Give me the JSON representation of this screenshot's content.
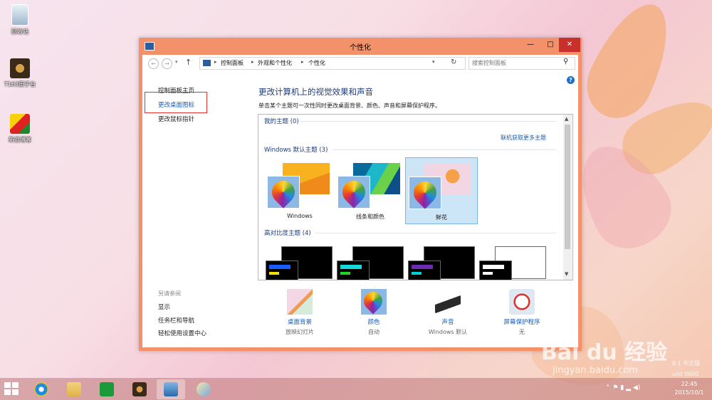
{
  "desktop": {
    "icons": [
      {
        "label": "回收站"
      },
      {
        "label": "T163田子台"
      },
      {
        "label": "新浪博客"
      }
    ]
  },
  "window": {
    "title": "个性化",
    "minimize_glyph": "—",
    "maximize_glyph": "□",
    "close_glyph": "✕"
  },
  "address": {
    "back_glyph": "←",
    "forward_glyph": "→",
    "dropdown_glyph": "▾",
    "up_glyph": "↑",
    "breadcrumb": [
      "控制面板",
      "外观和个性化",
      "个性化"
    ],
    "separator": "▸",
    "refresh_glyph": "↻",
    "search_placeholder": "搜索控制面板",
    "search_glyph": "⚲"
  },
  "sidebar": {
    "links": [
      "控制面板主页",
      "更改桌面图标",
      "更改鼠标指针"
    ],
    "see_also_title": "另请参阅",
    "see_also": [
      "显示",
      "任务栏和导航",
      "轻松使用设置中心"
    ]
  },
  "main": {
    "help": "?",
    "title": "更改计算机上的视觉效果和声音",
    "description": "单击某个主题可一次性同时更改桌面背景、颜色、声音和屏幕保护程序。",
    "my_themes": "我的主题 (0)",
    "get_more": "联机获取更多主题",
    "default_themes": "Windows 默认主题 (3)",
    "themes": [
      {
        "name": "Windows",
        "selected": false
      },
      {
        "name": "线条和颜色",
        "selected": false
      },
      {
        "name": "鲜花",
        "selected": true
      }
    ],
    "high_contrast": "高对比度主题 (4)",
    "hc_colors": [
      "#1a5cff",
      "#18d8d8",
      "#6a2cb0",
      "#ffffff"
    ],
    "scroll_up": "▲",
    "scroll_down": "▼"
  },
  "bottom": [
    {
      "title": "桌面背景",
      "subtitle": "放映幻灯片"
    },
    {
      "title": "颜色",
      "subtitle": "自动"
    },
    {
      "title": "声音",
      "subtitle": "Windows 默认"
    },
    {
      "title": "屏幕保护程序",
      "subtitle": "无"
    }
  ],
  "taskbar": {
    "clock_time": "22:45",
    "clock_date": "2015/10/1",
    "tray_icons": "⌃ ⚑ ▮ ▂ ◀)"
  },
  "watermark": {
    "brand": "Bai du 经验",
    "url": "jingyan.baidu.com",
    "build_line1": "8.1 中文版",
    "build_line2": "uild 9600"
  },
  "colors": {
    "window_frame": "#f2916a",
    "link_blue": "#1a5db5",
    "heading_blue": "#1e3b7a",
    "close_red": "#c7302b",
    "annotation_red": "#e03030"
  }
}
